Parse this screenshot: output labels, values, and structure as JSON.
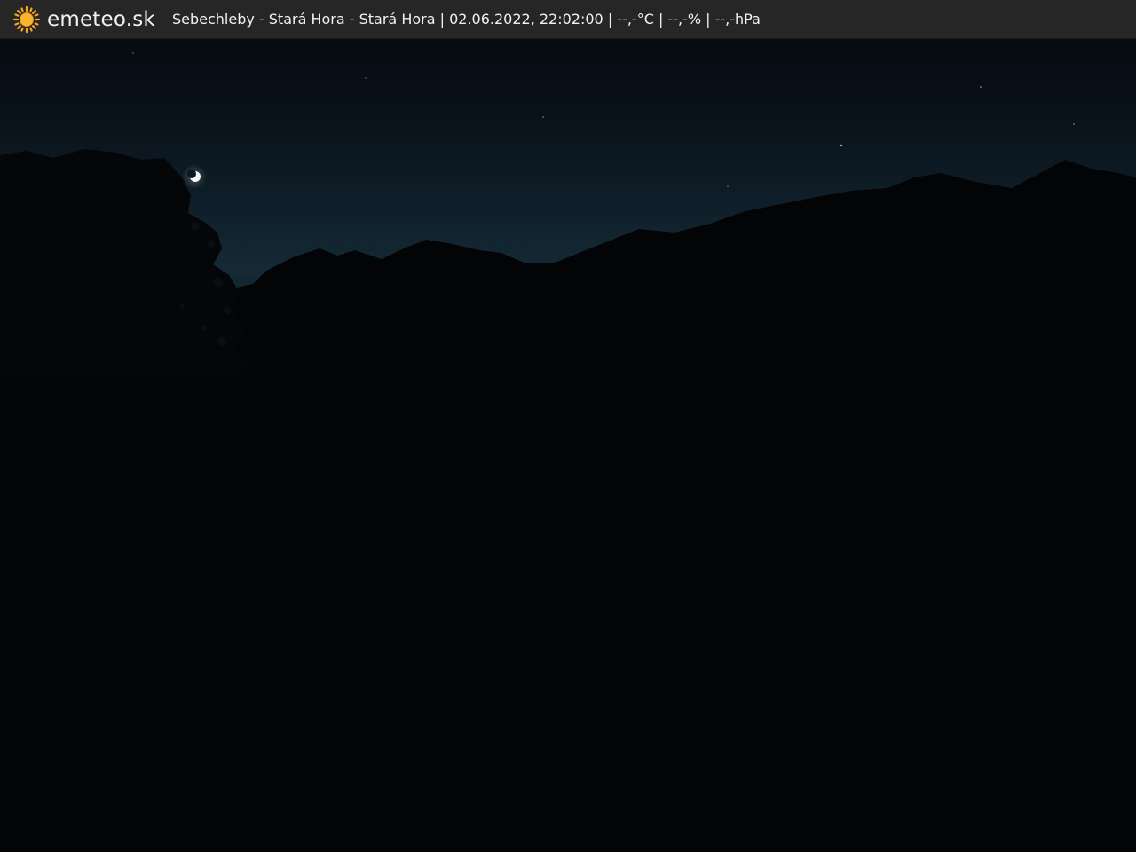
{
  "header": {
    "brand": "emeteo.sk",
    "logo_icon": "sun-icon",
    "caption": "Sebechleby - Stará Hora - Stará Hora | 02.06.2022, 22:02:00 | --,-°C | --,-% | --,-hPa"
  },
  "colors": {
    "bar": "#262626",
    "text": "#f2f2f2",
    "sun": "#f5a623",
    "sky_top": "#070a10",
    "sky_horizon": "#142833",
    "ground": "#050607",
    "moon": "#f4f6f8"
  },
  "scene": {
    "description_icon": "webcam-night-view",
    "features": [
      "moon",
      "tree-silhouettes",
      "hill-silhouette",
      "stars"
    ]
  }
}
